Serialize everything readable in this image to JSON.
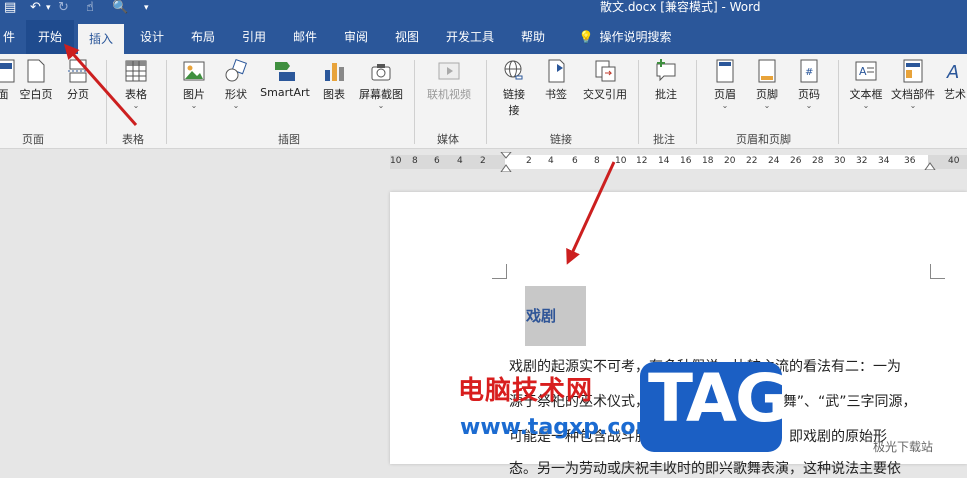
{
  "window": {
    "title": "散文.docx [兼容模式] - Word"
  },
  "tabs": [
    {
      "label": "件"
    },
    {
      "label": "开始"
    },
    {
      "label": "插入"
    },
    {
      "label": "设计"
    },
    {
      "label": "布局"
    },
    {
      "label": "引用"
    },
    {
      "label": "邮件"
    },
    {
      "label": "审阅"
    },
    {
      "label": "视图"
    },
    {
      "label": "开发工具"
    },
    {
      "label": "帮助"
    },
    {
      "label": "操作说明搜索"
    }
  ],
  "ribbon": {
    "buttons": [
      {
        "label": "面"
      },
      {
        "label": "空白页"
      },
      {
        "label": "分页"
      },
      {
        "label": "表格"
      },
      {
        "label": "图片"
      },
      {
        "label": "形状"
      },
      {
        "label": "SmartArt"
      },
      {
        "label": "图表"
      },
      {
        "label": "屏幕截图"
      },
      {
        "label": "联机视频"
      },
      {
        "label": "链接"
      },
      {
        "label": "书签"
      },
      {
        "label": "交叉引用"
      },
      {
        "label": "批注"
      },
      {
        "label": "页眉"
      },
      {
        "label": "页脚"
      },
      {
        "label": "页码"
      },
      {
        "label": "文本框"
      },
      {
        "label": "文档部件"
      },
      {
        "label": "艺术"
      }
    ],
    "groups": [
      {
        "label": "页面"
      },
      {
        "label": "表格"
      },
      {
        "label": "插图"
      },
      {
        "label": "媒体"
      },
      {
        "label": "链接"
      },
      {
        "label": "批注"
      },
      {
        "label": "页眉和页脚"
      }
    ]
  },
  "ruler": {
    "ticks": [
      "10",
      "8",
      "6",
      "4",
      "2",
      "2",
      "4",
      "6",
      "8",
      "10",
      "12",
      "14",
      "16",
      "18",
      "20",
      "22",
      "24",
      "26",
      "28",
      "30",
      "32",
      "34",
      "36",
      "40"
    ]
  },
  "document": {
    "heading": "戏剧",
    "lines": [
      "戏剧的起源实不可考，有多种假说。比较主流的看法有二：一为",
      "源于祭祀的巫术仪式，比如上古中文“巫”、“舞”、“武”三字同源，",
      "可能是一种包含战斗胜利的巫术活动的合称，即戏剧的原始形",
      "态。另一为劳动或庆祝丰收时的即兴歌舞表演，这种说法主要依"
    ]
  },
  "watermark": {
    "cn": "电脑技术网",
    "url": "www.tagxp.com",
    "tag": "TAG",
    "site": "极光下载站"
  },
  "colors": {
    "accent": "#2b579a",
    "arrow": "#cc1f1f"
  }
}
